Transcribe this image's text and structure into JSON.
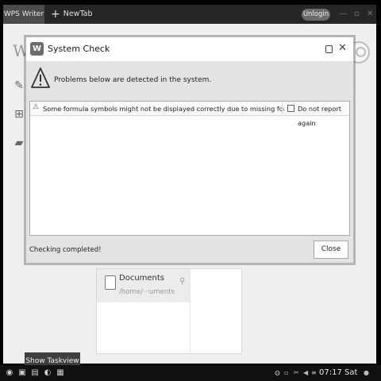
{
  "wps": {
    "tab_active": "WPS Writer",
    "tab_new": "NewTab",
    "unlogin_label": "Unlogin",
    "logo_text": "W"
  },
  "recent": {
    "title": "Documents",
    "path": "/home/···uments"
  },
  "dialog": {
    "title": "System Check",
    "icon_letter": "W",
    "warning_text": "Problems below are detected in the system.",
    "list": [
      {
        "message": "Some formula symbols might not be displayed correctly due to missing fonts Symbol, ···",
        "checkbox_label": "Do not report again",
        "checked": false
      }
    ],
    "status": "Checking completed!",
    "close_button": "Close"
  },
  "tooltip": "Show Taskview",
  "taskbar": {
    "clock": "07:17 Sat"
  }
}
